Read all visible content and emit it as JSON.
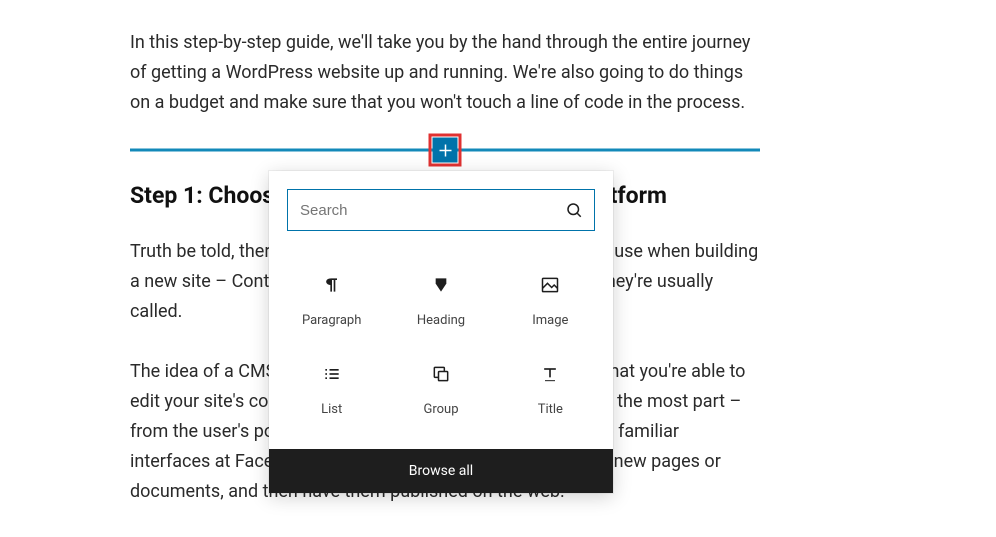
{
  "content": {
    "intro": "In this step-by-step guide, we'll take you by the hand through the entire journey of getting a WordPress website up and running. We're also going to do things on a budget and make sure that you won't touch a line of code in the process.",
    "heading": "Step 1: Choose WordPress as your website platform",
    "p2": "Truth be told, there are many website platforms that you can use when building a new site – Content Management Systems (CMS) is what they're usually called.",
    "p3": "The idea of a CMS is to give you some easy-to-use tools so that you're able to edit your site's content without any knowledge of coding. For the most part – from the user's point of view – those CMS look much like the familiar interfaces at Facebook or Google Docs. You basically create new pages or documents, and then have them published on the web."
  },
  "inserter": {
    "search_placeholder": "Search",
    "blocks": [
      {
        "label": "Paragraph"
      },
      {
        "label": "Heading"
      },
      {
        "label": "Image"
      },
      {
        "label": "List"
      },
      {
        "label": "Group"
      },
      {
        "label": "Title"
      }
    ],
    "browse_all": "Browse all"
  }
}
